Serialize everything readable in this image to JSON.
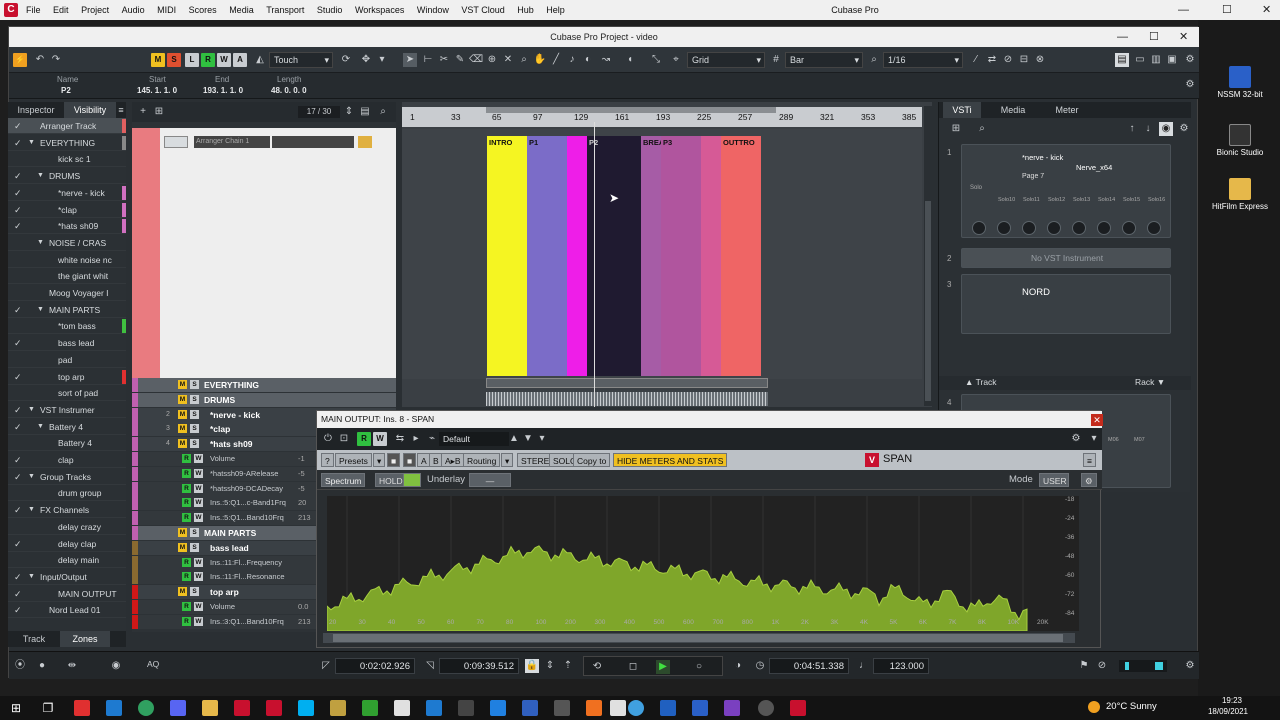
{
  "topbar": {
    "menu": [
      "File",
      "Edit",
      "Project",
      "Audio",
      "MIDI",
      "Scores",
      "Media",
      "Transport",
      "Studio",
      "Workspaces",
      "Window",
      "VST Cloud",
      "Hub",
      "Help"
    ],
    "app_title": "Cubase Pro",
    "minimize": "—",
    "maximize": "☐",
    "close": "✕"
  },
  "window": {
    "title": "Cubase Pro Project - video",
    "automation_mode": "Touch",
    "snap_type": "Grid",
    "grid_type": "Bar",
    "quantize": "1/16",
    "toolbar_letters": [
      "M",
      "S",
      "L",
      "R",
      "W",
      "A"
    ]
  },
  "info": {
    "name_label": "Name",
    "name_value": "P2",
    "start_label": "Start",
    "start_value": "145. 1. 1.  0",
    "end_label": "End",
    "end_value": "193. 1. 1.  0",
    "length_label": "Length",
    "length_value": "48. 0. 0.  0"
  },
  "inspector": {
    "tab_inspector": "Inspector",
    "tab_visibility": "Visibility",
    "tab_track": "Track",
    "tab_zones": "Zones",
    "rows": [
      {
        "label": "Arranger Track",
        "checked": true,
        "indent": 0,
        "folder": false,
        "color": "#e06060"
      },
      {
        "label": "EVERYTHING",
        "checked": true,
        "indent": 0,
        "folder": true,
        "color": "#888"
      },
      {
        "label": "kick sc 1",
        "checked": false,
        "indent": 2,
        "folder": false,
        "color": ""
      },
      {
        "label": "DRUMS",
        "checked": true,
        "indent": 1,
        "folder": true,
        "color": ""
      },
      {
        "label": "*nerve - kick",
        "checked": true,
        "indent": 2,
        "folder": false,
        "color": "#d070c0"
      },
      {
        "label": "*clap",
        "checked": true,
        "indent": 2,
        "folder": false,
        "color": "#d070c0"
      },
      {
        "label": "*hats sh09",
        "checked": true,
        "indent": 2,
        "folder": false,
        "color": "#d070c0"
      },
      {
        "label": "NOISE / CRAS",
        "checked": false,
        "indent": 1,
        "folder": true,
        "color": ""
      },
      {
        "label": "white noise nc",
        "checked": false,
        "indent": 2,
        "folder": false,
        "color": ""
      },
      {
        "label": "the giant whit",
        "checked": false,
        "indent": 2,
        "folder": false,
        "color": ""
      },
      {
        "label": "Moog Voyager I",
        "checked": false,
        "indent": 1,
        "folder": false,
        "color": ""
      },
      {
        "label": "MAIN PARTS",
        "checked": true,
        "indent": 1,
        "folder": true,
        "color": ""
      },
      {
        "label": "*tom bass",
        "checked": false,
        "indent": 2,
        "folder": false,
        "color": "#40c040"
      },
      {
        "label": "bass lead",
        "checked": true,
        "indent": 2,
        "folder": false,
        "color": ""
      },
      {
        "label": "pad",
        "checked": false,
        "indent": 2,
        "folder": false,
        "color": ""
      },
      {
        "label": "top arp",
        "checked": true,
        "indent": 2,
        "folder": false,
        "color": "#e03030"
      },
      {
        "label": "sort of pad",
        "checked": false,
        "indent": 2,
        "folder": false,
        "color": ""
      },
      {
        "label": "VST Instrumer",
        "checked": true,
        "indent": 0,
        "folder": true,
        "color": ""
      },
      {
        "label": "Battery 4",
        "checked": true,
        "indent": 1,
        "folder": true,
        "color": ""
      },
      {
        "label": "Battery 4",
        "checked": false,
        "indent": 2,
        "folder": false,
        "color": ""
      },
      {
        "label": "clap",
        "checked": true,
        "indent": 2,
        "folder": false,
        "color": ""
      },
      {
        "label": "Group Tracks",
        "checked": true,
        "indent": 0,
        "folder": true,
        "color": ""
      },
      {
        "label": "drum group",
        "checked": false,
        "indent": 2,
        "folder": false,
        "color": ""
      },
      {
        "label": "FX Channels",
        "checked": true,
        "indent": 0,
        "folder": true,
        "color": ""
      },
      {
        "label": "delay crazy",
        "checked": false,
        "indent": 2,
        "folder": false,
        "color": ""
      },
      {
        "label": "delay clap",
        "checked": true,
        "indent": 2,
        "folder": false,
        "color": ""
      },
      {
        "label": "delay main",
        "checked": false,
        "indent": 2,
        "folder": false,
        "color": ""
      },
      {
        "label": "Input/Output",
        "checked": true,
        "indent": 0,
        "folder": true,
        "color": ""
      },
      {
        "label": "MAIN OUTPUT",
        "checked": true,
        "indent": 2,
        "folder": false,
        "color": ""
      },
      {
        "label": "Nord Lead 01",
        "checked": true,
        "indent": 1,
        "folder": false,
        "color": ""
      }
    ]
  },
  "tracklist": {
    "count": "17 / 30",
    "arranger_chain": "Arranger Chain 1",
    "rows": [
      {
        "label": "EVERYTHING",
        "type": "folder",
        "num": ""
      },
      {
        "label": "DRUMS",
        "type": "folder",
        "num": ""
      },
      {
        "label": "*nerve - kick",
        "type": "inst",
        "num": "2"
      },
      {
        "label": "*clap",
        "type": "inst",
        "num": "3"
      },
      {
        "label": "*hats sh09",
        "type": "inst",
        "num": "4"
      },
      {
        "label": "Volume",
        "type": "auto",
        "num": "",
        "value": "-1"
      },
      {
        "label": "*hatssh09-ARelease",
        "type": "auto",
        "num": "",
        "value": "-5"
      },
      {
        "label": "*hatssh09-DCADecay",
        "type": "auto",
        "num": "",
        "value": "-5"
      },
      {
        "label": "Ins.:5:Q1...c-Band1Frq",
        "type": "auto",
        "num": "",
        "value": "20"
      },
      {
        "label": "Ins.:5:Q1...Band10Frq",
        "type": "auto",
        "num": "",
        "value": "213"
      },
      {
        "label": "MAIN PARTS",
        "type": "folder",
        "num": ""
      },
      {
        "label": "bass lead",
        "type": "inst",
        "num": ""
      },
      {
        "label": "Ins.:11:Fl...Frequency",
        "type": "auto",
        "num": "",
        "value": ""
      },
      {
        "label": "Ins.:11:Fl...Resonance",
        "type": "auto",
        "num": "",
        "value": ""
      },
      {
        "label": "top arp",
        "type": "inst",
        "num": ""
      },
      {
        "label": "Volume",
        "type": "auto",
        "num": "",
        "value": "0.0"
      },
      {
        "label": "Ins.:3:Q1...Band10Frq",
        "type": "auto",
        "num": "",
        "value": "213"
      }
    ]
  },
  "ruler": {
    "bars": [
      "1",
      "33",
      "65",
      "97",
      "129",
      "161",
      "193",
      "225",
      "257",
      "289",
      "321",
      "353",
      "385"
    ]
  },
  "arranger_events": [
    {
      "label": "INTRO",
      "color": "#f5f522"
    },
    {
      "label": "P1",
      "color": "#7b6cc8"
    },
    {
      "label": "",
      "color": "#ee1ee8"
    },
    {
      "label": "P2",
      "color": "#1f1a30"
    },
    {
      "label": "BREA",
      "color": "#a65ca6"
    },
    {
      "label": "P3",
      "color": "#b0559e"
    },
    {
      "label": "",
      "color": "#d65a96"
    },
    {
      "label": "OUTTRO",
      "color": "#ef6565"
    }
  ],
  "vsti": {
    "tab_vsti": "VSTi",
    "tab_media": "Media",
    "tab_meter": "Meter",
    "slot1_name": "*nerve - kick",
    "slot1_plugin": "Nerve_x64",
    "slot1_page": "Page 7",
    "slot1_solo": "Solo",
    "slot1_knobs": [
      "Solo10",
      "Solo11",
      "Solo12",
      "Solo13",
      "Solo14",
      "Solo15",
      "Solo16"
    ],
    "slot2_text": "No VST Instrument",
    "slot3_name": "NORD",
    "track_label": "Track",
    "rack_label": "Rack",
    "slot4_knobs": [
      "M05",
      "M06",
      "M07"
    ]
  },
  "span": {
    "title": "MAIN OUTPUT: Ins. 8 - SPAN",
    "preset": "Default",
    "presets_label": "Presets",
    "routing_label": "Routing",
    "stereo_label": "STEREO",
    "solo_label": "SOLO",
    "copy_label": "Copy to",
    "hide_label": "HIDE METERS AND STATS",
    "ab_labels": [
      "A",
      "B",
      "A▸B"
    ],
    "help": "?",
    "brand": "SPAN",
    "spectrum_label": "Spectrum",
    "hold_label": "HOLD",
    "underlay_label": "Underlay",
    "underlay_value": "—",
    "mode_label": "Mode",
    "mode_value": "USER",
    "freq_labels": [
      "20",
      "30",
      "40",
      "50",
      "60",
      "70",
      "80",
      "100",
      "200",
      "300",
      "400",
      "500",
      "600",
      "700",
      "800",
      "1K",
      "2K",
      "3K",
      "4K",
      "5K",
      "6K",
      "7K",
      "8K",
      "10K",
      "20K"
    ],
    "db_labels": [
      "-18",
      "-24",
      "-36",
      "-48",
      "-60",
      "-72",
      "-84"
    ]
  },
  "transport": {
    "left_locator": "0:02:02.926",
    "right_locator": "0:09:39.512",
    "position": "0:04:51.338",
    "tempo": "123.000",
    "aq": "AQ"
  },
  "desktop": {
    "icons": [
      "NSSM 32-bit",
      "Bionic Studio",
      "HitFilm Express"
    ]
  },
  "taskbar": {
    "weather": "20°C  Sunny",
    "time": "19:23",
    "date": "18/09/2021"
  },
  "colors": {
    "accent_orange": "#f0a020",
    "spectrum_green": "#7fa62a"
  }
}
